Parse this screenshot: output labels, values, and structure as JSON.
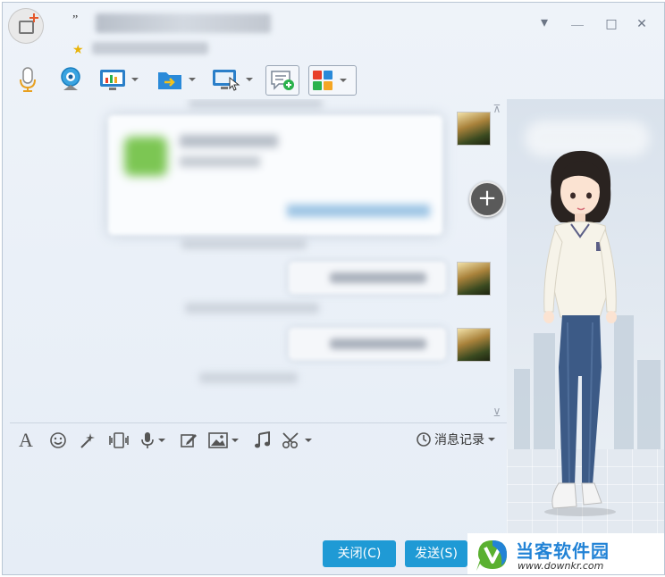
{
  "title_bar": {
    "quote_mark": "”",
    "star": "★",
    "minimize": "＿",
    "dropdown": "▾",
    "maximize": "□",
    "close": "✕"
  },
  "toolbar": {
    "items": [
      "microphone",
      "camera",
      "screen-share",
      "file-transfer",
      "remote-desktop",
      "chat-plus",
      "apps"
    ]
  },
  "input_toolbar": {
    "font_glyph": "A",
    "history_label": "消息记录"
  },
  "buttons": {
    "close_label": "关闭(C)",
    "send_label": "发送(S)"
  },
  "watermark": {
    "name": "当客软件园",
    "url": "www.downkr.com"
  },
  "colors": {
    "accent": "#1f9ad5",
    "watermark_green": "#5ab030",
    "watermark_blue": "#2283d6"
  }
}
